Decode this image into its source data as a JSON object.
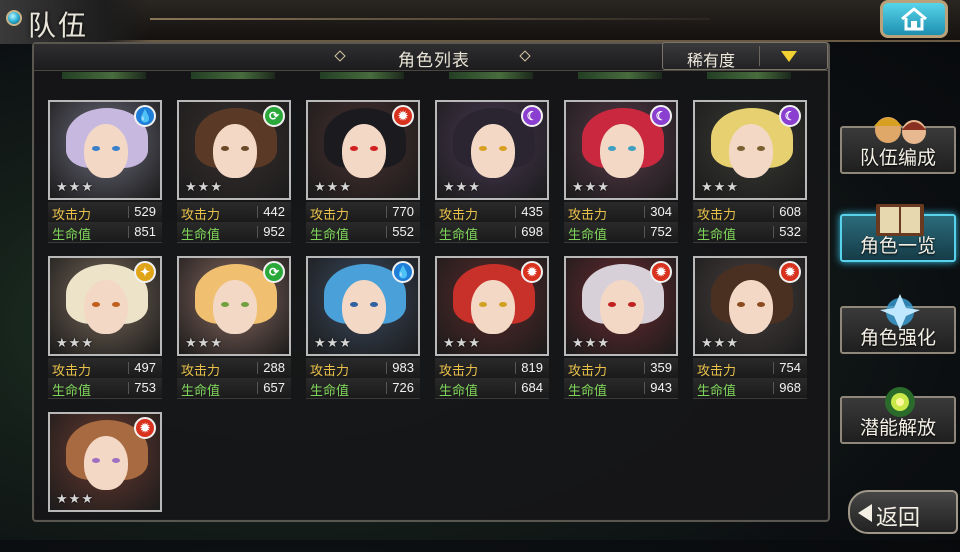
{
  "header": {
    "title": "队伍"
  },
  "panel": {
    "title": "角色列表",
    "sort_label": "稀有度"
  },
  "stat_labels": {
    "attack": "攻击力",
    "hp": "生命值"
  },
  "characters": [
    {
      "element": "water",
      "attack": "529",
      "hp": "851",
      "stars": 3,
      "hair": "#c7b8df",
      "bg": "#6d6d7d",
      "eye": "#3a7fc9"
    },
    {
      "element": "wind",
      "attack": "442",
      "hp": "952",
      "stars": 3,
      "hair": "#5a3a26",
      "bg": "#3a3030",
      "eye": "#6b4a2a"
    },
    {
      "element": "fire",
      "attack": "770",
      "hp": "552",
      "stars": 3,
      "hair": "#1b1b1f",
      "bg": "#4a3030",
      "eye": "#d02020"
    },
    {
      "element": "dark",
      "attack": "435",
      "hp": "698",
      "stars": 3,
      "hair": "#2a2530",
      "bg": "#4a3a55",
      "eye": "#d8a020"
    },
    {
      "element": "dark",
      "attack": "304",
      "hp": "752",
      "stars": 3,
      "hair": "#c9283f",
      "bg": "#5a3a4a",
      "eye": "#3fa0c0"
    },
    {
      "element": "dark",
      "attack": "608",
      "hp": "532",
      "stars": 3,
      "hair": "#e6d070",
      "bg": "#3a3a35",
      "eye": "#7a6030"
    },
    {
      "element": "light",
      "attack": "497",
      "hp": "753",
      "stars": 3,
      "hair": "#ece3c8",
      "bg": "#7a6a5a",
      "eye": "#c06020"
    },
    {
      "element": "wind",
      "attack": "288",
      "hp": "657",
      "stars": 3,
      "hair": "#f0c070",
      "bg": "#8a6a60",
      "eye": "#70a040"
    },
    {
      "element": "water",
      "attack": "983",
      "hp": "726",
      "stars": 3,
      "hair": "#4aa0d8",
      "bg": "#3a4a60",
      "eye": "#3060a0"
    },
    {
      "element": "fire",
      "attack": "819",
      "hp": "684",
      "stars": 3,
      "hair": "#c8302a",
      "bg": "#5a2a2a",
      "eye": "#d0a020"
    },
    {
      "element": "fire",
      "attack": "359",
      "hp": "943",
      "stars": 3,
      "hair": "#d8d0d8",
      "bg": "#6a2a30",
      "eye": "#c02020"
    },
    {
      "element": "fire",
      "attack": "754",
      "hp": "968",
      "stars": 3,
      "hair": "#4a3020",
      "bg": "#4a4040",
      "eye": "#8a4a20"
    },
    {
      "element": "fire",
      "attack": "",
      "hp": "",
      "stars": 3,
      "hair": "#a86a40",
      "bg": "#6a3a30",
      "eye": "#a070c0"
    }
  ],
  "element_colors": {
    "water": "#1f7ed8",
    "wind": "#2aa83a",
    "fire": "#d8321e",
    "dark": "#8b3fd0",
    "light": "#e0a418"
  },
  "element_glyphs": {
    "water": "💧",
    "wind": "⟳",
    "fire": "✹",
    "dark": "☾",
    "light": "✦"
  },
  "sidebar": {
    "items": [
      {
        "label": "队伍编成",
        "active": false
      },
      {
        "label": "角色一览",
        "active": true
      },
      {
        "label": "角色强化",
        "active": false
      },
      {
        "label": "潜能解放",
        "active": false
      }
    ]
  },
  "back": {
    "label": "返回"
  },
  "icons": {
    "home": "home-icon",
    "sort": "triangle-down-icon",
    "back": "arrow-left-icon"
  }
}
